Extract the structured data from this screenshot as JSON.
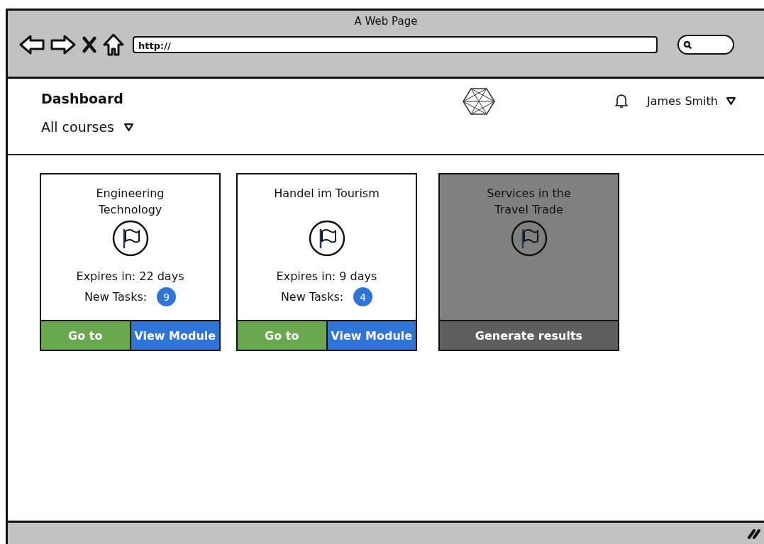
{
  "browser": {
    "title": "A Web Page",
    "url": "http://"
  },
  "header": {
    "title": "Dashboard",
    "user": "James Smith",
    "filter": "All courses"
  },
  "cards": [
    {
      "title": "Engineering Technology",
      "disabled": false,
      "expires": "Expires in: 22 days",
      "tasks_label": "New Tasks:",
      "tasks_count": "9",
      "buttons": [
        {
          "kind": "go",
          "label": "Go to"
        },
        {
          "kind": "view",
          "label": "View Module"
        }
      ]
    },
    {
      "title": "Handel im Tourism",
      "disabled": false,
      "expires": "Expires in: 9 days",
      "tasks_label": "New Tasks:",
      "tasks_count": "4",
      "buttons": [
        {
          "kind": "go",
          "label": "Go to"
        },
        {
          "kind": "view",
          "label": "View Module"
        }
      ]
    },
    {
      "title": "Services in the Travel Trade",
      "disabled": true,
      "buttons": [
        {
          "kind": "generate",
          "label": "Generate results"
        }
      ]
    }
  ]
}
